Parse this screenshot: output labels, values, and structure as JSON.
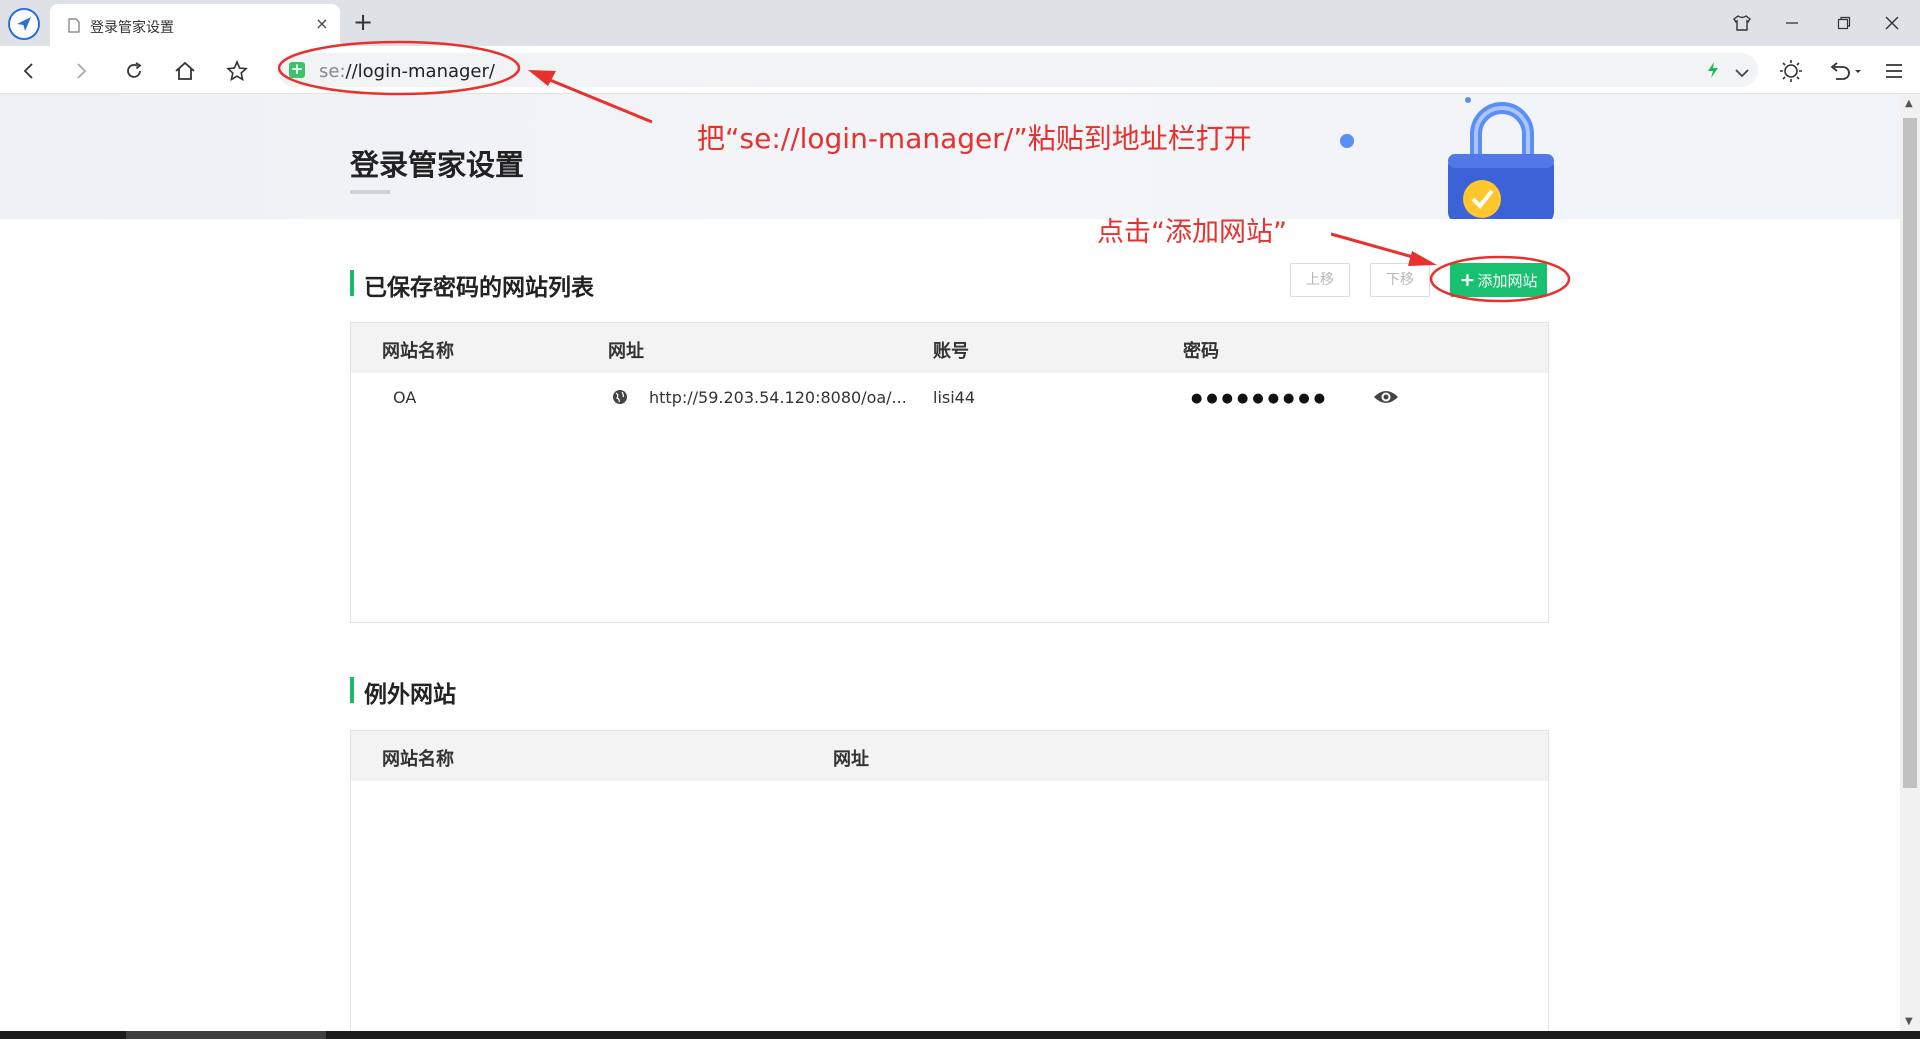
{
  "browser": {
    "tab_title": "登录管家设置",
    "tab_close": "×",
    "new_tab": "+",
    "url_scheme": "se:",
    "url_path": "//login-manager/"
  },
  "page": {
    "title": "登录管家设置",
    "saved_section": {
      "title": "已保存密码的网站列表",
      "move_up_label": "上移",
      "move_down_label": "下移",
      "add_site_label": "添加网站",
      "columns": [
        "网站名称",
        "网址",
        "账号",
        "密码"
      ],
      "rows": [
        {
          "name": "OA",
          "url": "http://59.203.54.120:8080/oa/...",
          "account": "lisi44",
          "password_mask": "●●●●●●●●●"
        }
      ]
    },
    "exception_section": {
      "title": "例外网站",
      "columns": [
        "网站名称",
        "网址"
      ]
    }
  },
  "annotations": {
    "paste_note": "把“se://login-manager/”粘贴到地址栏打开",
    "click_note": "点击“添加网站”"
  },
  "colors": {
    "accent_green": "#18c070",
    "section_bar": "#1db66b",
    "annotation_red": "#e8312f"
  }
}
